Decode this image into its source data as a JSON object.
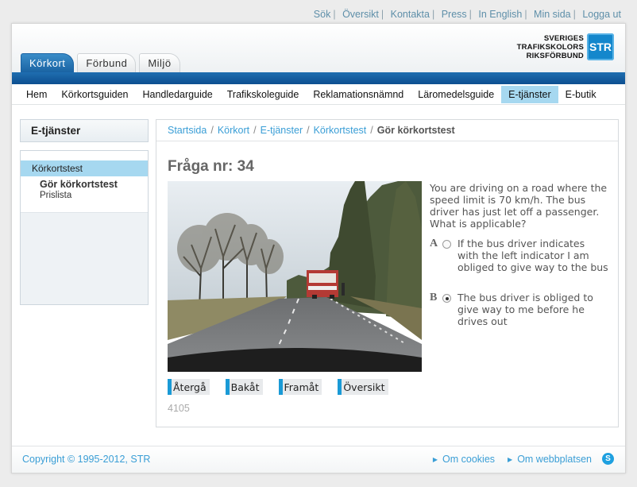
{
  "top_links": [
    "Sök",
    "Översikt",
    "Kontakta",
    "Press",
    "In English",
    "Min sida",
    "Logga ut"
  ],
  "logo": {
    "line1": "SVERIGES",
    "line2": "TRAFIKSKOLORS",
    "line3": "RIKSFÖRBUND",
    "badge": "STR"
  },
  "tabs": [
    "Körkort",
    "Förbund",
    "Miljö"
  ],
  "main_nav": [
    "Hem",
    "Körkortsguiden",
    "Handledarguide",
    "Trafikskoleguide",
    "Reklamationsnämnd",
    "Läromedelsguide",
    "E-tjänster",
    "E-butik"
  ],
  "sidebar": {
    "title": "E-tjänster",
    "item": "Körkortstest",
    "sub1": "Gör körkortstest",
    "sub2": "Prislista"
  },
  "breadcrumb": {
    "items": [
      "Startsida",
      "Körkort",
      "E-tjänster",
      "Körkortstest"
    ],
    "current": "Gör körkortstest"
  },
  "question": {
    "title": "Fråga nr: 34",
    "text": "You are driving on a road where the speed limit is 70 km/h. The bus driver has just let off a passenger. What is applicable?",
    "answers": [
      {
        "letter": "A",
        "text": "If the bus driver indicates with the left indicator I am obliged to give way to the bus",
        "selected": false
      },
      {
        "letter": "B",
        "text": "The bus driver is obliged to give way to me before he drives out",
        "selected": true
      }
    ],
    "id": "4105"
  },
  "buttons": [
    "Återgå",
    "Bakåt",
    "Framåt",
    "Översikt"
  ],
  "footer": {
    "copyright": "Copyright © 1995-2012, STR",
    "links": [
      "Om cookies",
      "Om webbplatsen"
    ]
  },
  "colors": {
    "brand_blue": "#1a63a3",
    "accent_light_blue": "#a6d8f0",
    "link_blue": "#3a9ed6"
  }
}
